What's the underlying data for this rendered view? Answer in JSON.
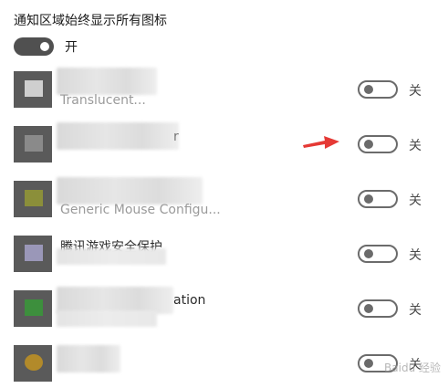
{
  "header": {
    "title": "通知区域始终显示所有图标"
  },
  "master_toggle": {
    "state_label": "开",
    "on": true
  },
  "apps": [
    {
      "visible_text": "Translucent...",
      "icon_tint": "#cccccc",
      "toggle_label": "关",
      "on": false
    },
    {
      "visible_text": "r",
      "icon_tint": "#888888",
      "toggle_label": "关",
      "on": false
    },
    {
      "visible_text": "Generic Mouse Configu...",
      "icon_tint": "#8b8f3a",
      "toggle_label": "关",
      "on": false
    },
    {
      "visible_text": "腾讯游戏安全保护",
      "icon_tint": "#9a97b8",
      "toggle_label": "关",
      "on": false
    },
    {
      "visible_text": "ation",
      "icon_tint": "#3d8f3d",
      "toggle_label": "关",
      "on": false
    },
    {
      "visible_text": "",
      "icon_tint": "#b28a2a",
      "toggle_label": "关",
      "on": false
    }
  ],
  "annotation": {
    "arrow_color": "#e53935"
  },
  "watermark": {
    "text": "Baidu 经验"
  }
}
